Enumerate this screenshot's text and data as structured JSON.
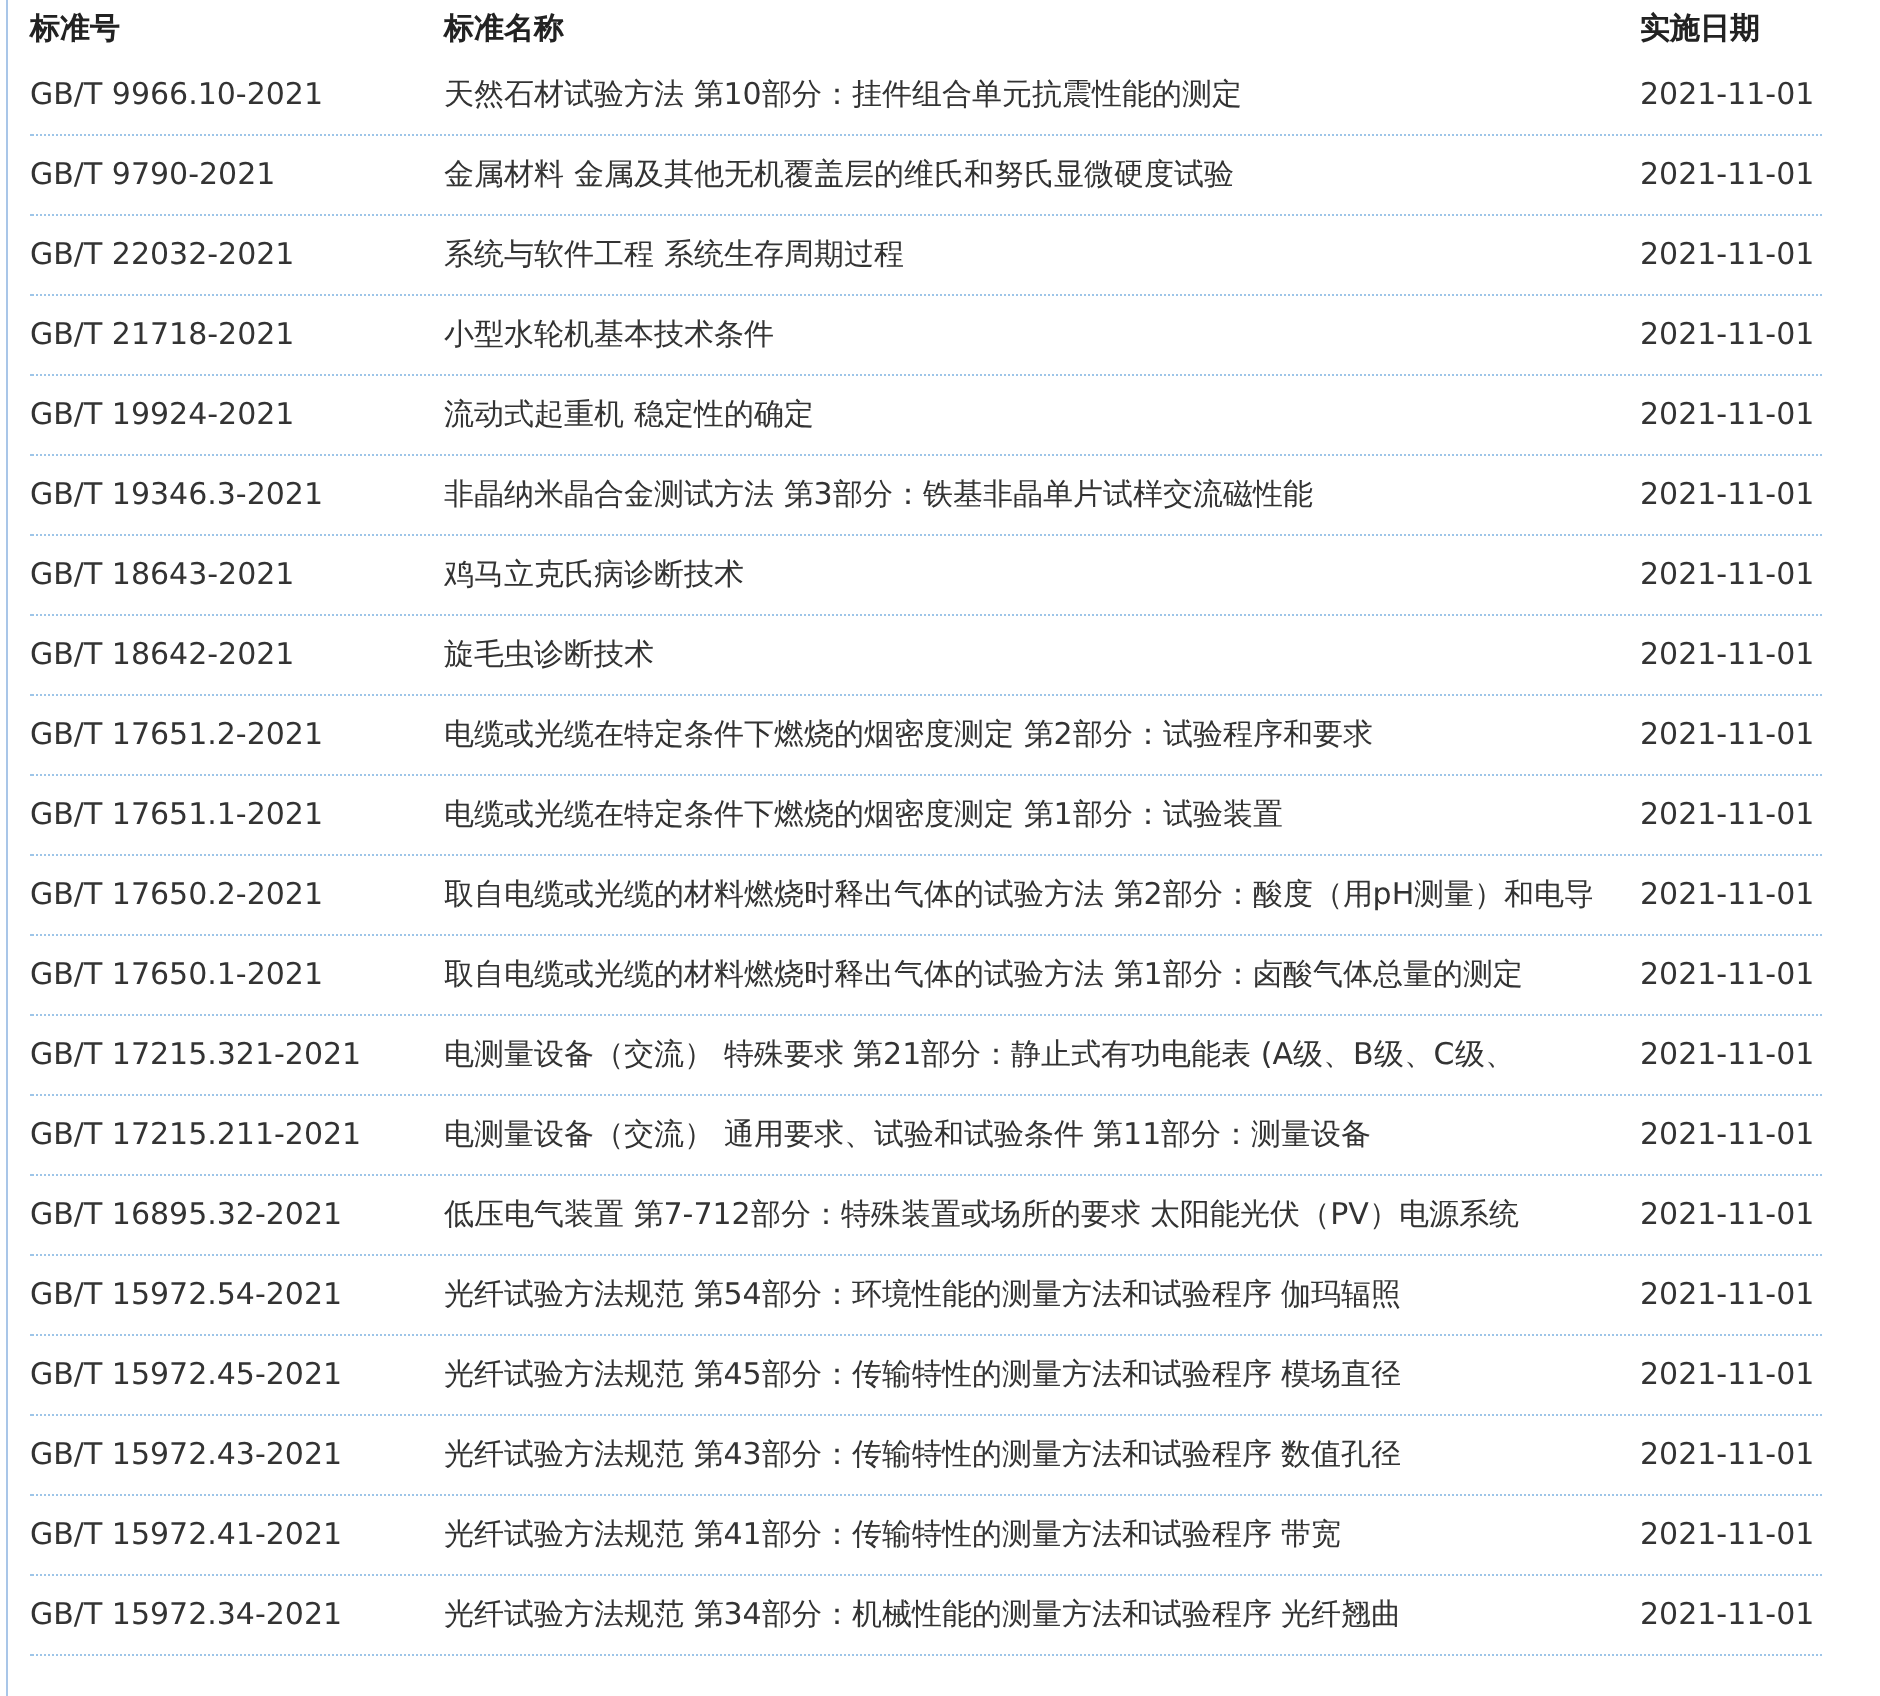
{
  "table": {
    "columns": [
      "标准号",
      "标准名称",
      "实施日期"
    ],
    "rows": [
      {
        "code": "GB/T 9966.10-2021",
        "name": "天然石材试验方法 第10部分：挂件组合单元抗震性能的测定",
        "date": "2021-11-01"
      },
      {
        "code": "GB/T 9790-2021",
        "name": "金属材料 金属及其他无机覆盖层的维氏和努氏显微硬度试验",
        "date": "2021-11-01"
      },
      {
        "code": "GB/T 22032-2021",
        "name": "系统与软件工程 系统生存周期过程",
        "date": "2021-11-01"
      },
      {
        "code": "GB/T 21718-2021",
        "name": "小型水轮机基本技术条件",
        "date": "2021-11-01"
      },
      {
        "code": "GB/T 19924-2021",
        "name": "流动式起重机 稳定性的确定",
        "date": "2021-11-01"
      },
      {
        "code": "GB/T 19346.3-2021",
        "name": "非晶纳米晶合金测试方法 第3部分：铁基非晶单片试样交流磁性能",
        "date": "2021-11-01"
      },
      {
        "code": "GB/T 18643-2021",
        "name": "鸡马立克氏病诊断技术",
        "date": "2021-11-01"
      },
      {
        "code": "GB/T 18642-2021",
        "name": "旋毛虫诊断技术",
        "date": "2021-11-01"
      },
      {
        "code": "GB/T 17651.2-2021",
        "name": "电缆或光缆在特定条件下燃烧的烟密度测定 第2部分：试验程序和要求",
        "date": "2021-11-01"
      },
      {
        "code": "GB/T 17651.1-2021",
        "name": "电缆或光缆在特定条件下燃烧的烟密度测定 第1部分：试验装置",
        "date": "2021-11-01"
      },
      {
        "code": "GB/T 17650.2-2021",
        "name": "取自电缆或光缆的材料燃烧时释出气体的试验方法 第2部分：酸度（用pH测量）和电导",
        "date": "2021-11-01"
      },
      {
        "code": "GB/T 17650.1-2021",
        "name": "取自电缆或光缆的材料燃烧时释出气体的试验方法 第1部分：卤酸气体总量的测定",
        "date": "2021-11-01"
      },
      {
        "code": "GB/T 17215.321-2021",
        "name": "电测量设备（交流） 特殊要求 第21部分：静止式有功电能表 (A级、B级、C级、",
        "date": "2021-11-01"
      },
      {
        "code": "GB/T 17215.211-2021",
        "name": "电测量设备（交流） 通用要求、试验和试验条件 第11部分：测量设备",
        "date": "2021-11-01"
      },
      {
        "code": "GB/T 16895.32-2021",
        "name": "低压电气装置 第7-712部分：特殊装置或场所的要求 太阳能光伏（PV）电源系统",
        "date": "2021-11-01"
      },
      {
        "code": "GB/T 15972.54-2021",
        "name": "光纤试验方法规范 第54部分：环境性能的测量方法和试验程序 伽玛辐照",
        "date": "2021-11-01"
      },
      {
        "code": "GB/T 15972.45-2021",
        "name": "光纤试验方法规范 第45部分：传输特性的测量方法和试验程序 模场直径",
        "date": "2021-11-01"
      },
      {
        "code": "GB/T 15972.43-2021",
        "name": "光纤试验方法规范 第43部分：传输特性的测量方法和试验程序 数值孔径",
        "date": "2021-11-01"
      },
      {
        "code": "GB/T 15972.41-2021",
        "name": "光纤试验方法规范 第41部分：传输特性的测量方法和试验程序 带宽",
        "date": "2021-11-01"
      },
      {
        "code": "GB/T 15972.34-2021",
        "name": "光纤试验方法规范 第34部分：机械性能的测量方法和试验程序 光纤翘曲",
        "date": "2021-11-01"
      }
    ]
  }
}
